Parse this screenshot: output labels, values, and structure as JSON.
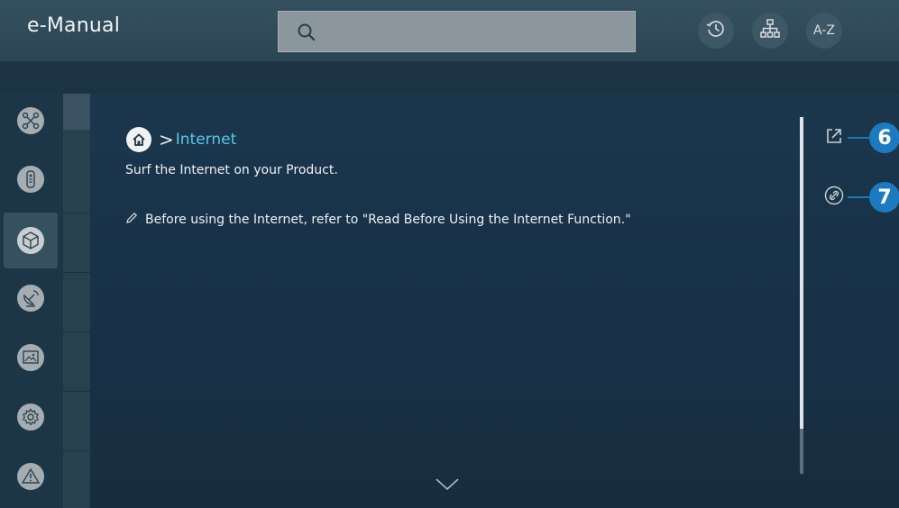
{
  "header": {
    "title": "e-Manual",
    "search": {
      "value": "",
      "icon": "search-icon"
    },
    "buttons": [
      {
        "name": "recent-history-icon"
      },
      {
        "name": "sitemap-icon"
      },
      {
        "label": "A-Z"
      }
    ]
  },
  "sidebar": {
    "items": [
      {
        "icon": "smart-features-icon"
      },
      {
        "icon": "remote-control-icon"
      },
      {
        "icon": "connections-icon",
        "active": true
      },
      {
        "icon": "broadcast-satellite-icon"
      },
      {
        "icon": "picture-sound-icon"
      },
      {
        "icon": "settings-gear-icon"
      },
      {
        "icon": "warning-troubleshooting-icon"
      }
    ]
  },
  "breadcrumb": {
    "separator": ">",
    "current": "Internet"
  },
  "content": {
    "description": "Surf the Internet on your Product.",
    "note": "Before using the Internet, refer to \"Read Before Using the Internet Function.\""
  },
  "actions": [
    {
      "icon": "open-external-icon",
      "callout": "6"
    },
    {
      "icon": "link-icon",
      "callout": "7"
    }
  ],
  "colors": {
    "accent": "#58c7e8",
    "callout": "#1b7ac0"
  }
}
